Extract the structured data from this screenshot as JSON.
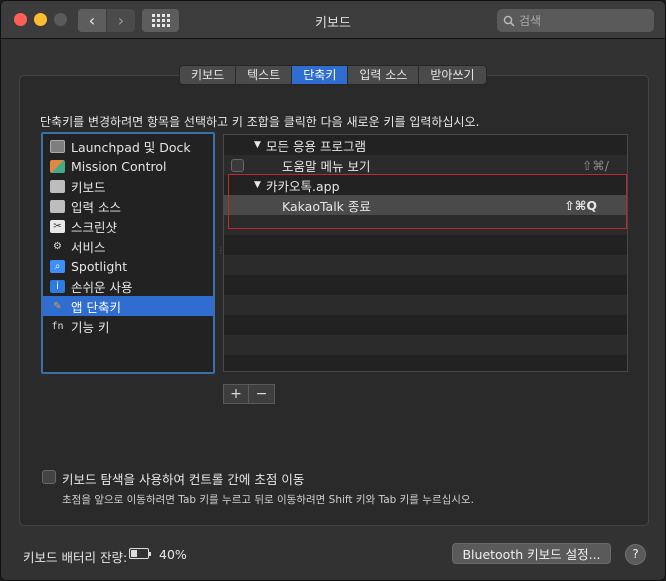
{
  "window": {
    "title": "키보드",
    "search_placeholder": "검색",
    "nav_back_glyph": "‹",
    "nav_forward_glyph": "›"
  },
  "tabs": [
    {
      "label": "키보드",
      "active": false
    },
    {
      "label": "텍스트",
      "active": false
    },
    {
      "label": "단축키",
      "active": true
    },
    {
      "label": "입력 소스",
      "active": false
    },
    {
      "label": "받아쓰기",
      "active": false
    }
  ],
  "instruction": "단축키를 변경하려면 항목을 선택하고 키 조합을 클릭한 다음 새로운 키를 입력하십시오.",
  "categories": [
    {
      "label": "Launchpad 및 Dock",
      "icon": "launchpad-icon",
      "glyph": ""
    },
    {
      "label": "Mission Control",
      "icon": "mission-control-icon",
      "glyph": ""
    },
    {
      "label": "키보드",
      "icon": "keyboard-icon",
      "glyph": ""
    },
    {
      "label": "입력 소스",
      "icon": "input-source-icon",
      "glyph": ""
    },
    {
      "label": "스크린샷",
      "icon": "screenshot-icon",
      "glyph": "✂"
    },
    {
      "label": "서비스",
      "icon": "gear-icon",
      "glyph": "⚙"
    },
    {
      "label": "Spotlight",
      "icon": "spotlight-icon",
      "glyph": "⌕"
    },
    {
      "label": "손쉬운 사용",
      "icon": "accessibility-icon",
      "glyph": "i"
    },
    {
      "label": "앱 단축키",
      "icon": "app-shortcuts-icon",
      "glyph": "✎",
      "selected": true
    },
    {
      "label": "기능 키",
      "icon": "fn-key-icon",
      "glyph": "fn"
    }
  ],
  "shortcuts": {
    "groups": [
      {
        "label": "모든 응용 프로그램",
        "items": [
          {
            "label": "도움말 메뉴 보기",
            "shortcut": "⇧⌘/"
          }
        ]
      },
      {
        "label": "카카오톡.app",
        "items": [
          {
            "label": "KakaoTalk 종료",
            "shortcut": "⇧⌘Q"
          }
        ]
      }
    ],
    "disclosure_glyph": "▼"
  },
  "buttons": {
    "add": "+",
    "remove": "−"
  },
  "keyboard_navigation": {
    "label": "키보드 탐색을 사용하여 컨트롤 간에 초점 이동",
    "hint": "초점을 앞으로 이동하려면 Tab 키를 누르고 뒤로 이동하려면 Shift 키와 Tab 키를 누르십시오.",
    "checked": false
  },
  "footer": {
    "battery_label": "키보드 배터리 잔량:",
    "battery_percent": "40%",
    "battery_level": 0.4,
    "bluetooth_button": "Bluetooth 키보드 설정...",
    "help": "?"
  }
}
